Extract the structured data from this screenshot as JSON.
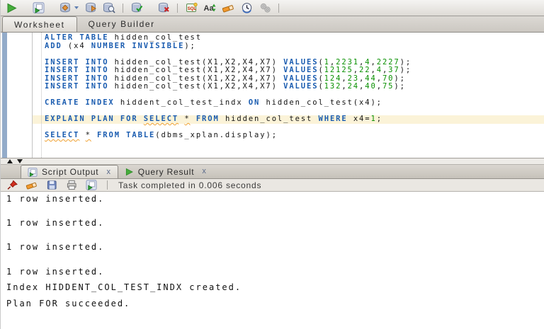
{
  "colors": {
    "keyword": "#1a5cb0",
    "number": "#089000",
    "highlight_line": "#fbf3d8",
    "squiggle": "#efa02f",
    "run_green": "#46ad3c",
    "error_red": "#cc2222"
  },
  "toolbar_main": {
    "icons": [
      "run-statement",
      "run-script",
      "autotrace",
      "explain-plan",
      "sql-tuning-advisor",
      "commit",
      "rollback",
      "unshared-worksheet",
      "case-toggle",
      "clear",
      "sql-history",
      "cancel-task"
    ]
  },
  "tabs_top": {
    "items": [
      {
        "label": "Worksheet",
        "active": true
      },
      {
        "label": "Query Builder",
        "active": false
      }
    ]
  },
  "editor": {
    "lines": [
      {
        "hl": false,
        "tokens": [
          {
            "t": "kw",
            "s": "ALTER TABLE"
          },
          {
            "t": "pl",
            "s": " hidden_col_test"
          }
        ]
      },
      {
        "hl": false,
        "tokens": [
          {
            "t": "kw",
            "s": "ADD"
          },
          {
            "t": "pl",
            "s": " (x4 "
          },
          {
            "t": "kw",
            "s": "NUMBER INVISIBLE"
          },
          {
            "t": "pl",
            "s": ");"
          }
        ]
      },
      {
        "hl": false,
        "tokens": []
      },
      {
        "hl": false,
        "tokens": [
          {
            "t": "kw",
            "s": "INSERT INTO"
          },
          {
            "t": "pl",
            "s": " hidden_col_test(X1,X2,X4,X7) "
          },
          {
            "t": "kw",
            "s": "VALUES"
          },
          {
            "t": "pl",
            "s": "("
          },
          {
            "t": "num",
            "s": "1"
          },
          {
            "t": "pl",
            "s": ","
          },
          {
            "t": "num",
            "s": "2231"
          },
          {
            "t": "pl",
            "s": ","
          },
          {
            "t": "num",
            "s": "4"
          },
          {
            "t": "pl",
            "s": ","
          },
          {
            "t": "num",
            "s": "2227"
          },
          {
            "t": "pl",
            "s": ");"
          }
        ]
      },
      {
        "hl": false,
        "tokens": [
          {
            "t": "kw",
            "s": "INSERT INTO"
          },
          {
            "t": "pl",
            "s": " hidden_col_test(X1,X2,X4,X7) "
          },
          {
            "t": "kw",
            "s": "VALUES"
          },
          {
            "t": "pl",
            "s": "("
          },
          {
            "t": "num",
            "s": "12125"
          },
          {
            "t": "pl",
            "s": ","
          },
          {
            "t": "num",
            "s": "22"
          },
          {
            "t": "pl",
            "s": ","
          },
          {
            "t": "num",
            "s": "4"
          },
          {
            "t": "pl",
            "s": ","
          },
          {
            "t": "num",
            "s": "37"
          },
          {
            "t": "pl",
            "s": ");"
          }
        ]
      },
      {
        "hl": false,
        "tokens": [
          {
            "t": "kw",
            "s": "INSERT INTO"
          },
          {
            "t": "pl",
            "s": " hidden_col_test(X1,X2,X4,X7) "
          },
          {
            "t": "kw",
            "s": "VALUES"
          },
          {
            "t": "pl",
            "s": "("
          },
          {
            "t": "num",
            "s": "124"
          },
          {
            "t": "pl",
            "s": ","
          },
          {
            "t": "num",
            "s": "23"
          },
          {
            "t": "pl",
            "s": ","
          },
          {
            "t": "num",
            "s": "44"
          },
          {
            "t": "pl",
            "s": ","
          },
          {
            "t": "num",
            "s": "70"
          },
          {
            "t": "pl",
            "s": ");"
          }
        ]
      },
      {
        "hl": false,
        "tokens": [
          {
            "t": "kw",
            "s": "INSERT INTO"
          },
          {
            "t": "pl",
            "s": " hidden_col_test(X1,X2,X4,X7) "
          },
          {
            "t": "kw",
            "s": "VALUES"
          },
          {
            "t": "pl",
            "s": "("
          },
          {
            "t": "num",
            "s": "132"
          },
          {
            "t": "pl",
            "s": ","
          },
          {
            "t": "num",
            "s": "24"
          },
          {
            "t": "pl",
            "s": ","
          },
          {
            "t": "num",
            "s": "40"
          },
          {
            "t": "pl",
            "s": ","
          },
          {
            "t": "num",
            "s": "75"
          },
          {
            "t": "pl",
            "s": ");"
          }
        ]
      },
      {
        "hl": false,
        "tokens": []
      },
      {
        "hl": false,
        "tokens": [
          {
            "t": "kw",
            "s": "CREATE INDEX"
          },
          {
            "t": "pl",
            "s": " hiddent_col_test_indx "
          },
          {
            "t": "kw",
            "s": "ON"
          },
          {
            "t": "pl",
            "s": " hidden_col_test(x4);"
          }
        ]
      },
      {
        "hl": false,
        "tokens": []
      },
      {
        "hl": true,
        "tokens": [
          {
            "t": "kw",
            "s": "EXPLAIN PLAN FOR"
          },
          {
            "t": "pl",
            "s": " "
          },
          {
            "t": "kwu",
            "s": "SELECT"
          },
          {
            "t": "pl",
            "s": " "
          },
          {
            "t": "stu",
            "s": "*"
          },
          {
            "t": "pl",
            "s": " "
          },
          {
            "t": "kw",
            "s": "FROM"
          },
          {
            "t": "pl",
            "s": " hidden_col_test "
          },
          {
            "t": "kw",
            "s": "WHERE"
          },
          {
            "t": "pl",
            "s": " x4="
          },
          {
            "t": "num",
            "s": "1"
          },
          {
            "t": "pl",
            "s": ";"
          }
        ]
      },
      {
        "hl": false,
        "tokens": []
      },
      {
        "hl": false,
        "tokens": [
          {
            "t": "kwu",
            "s": "SELECT"
          },
          {
            "t": "pl",
            "s": " "
          },
          {
            "t": "stu",
            "s": "*"
          },
          {
            "t": "pl",
            "s": " "
          },
          {
            "t": "kw",
            "s": "FROM TABLE"
          },
          {
            "t": "pl",
            "s": "(dbms_xplan.display);"
          }
        ]
      }
    ]
  },
  "tabs_bottom": {
    "items": [
      {
        "icon": "run-script",
        "label": "Script Output",
        "close": "x",
        "active": true
      },
      {
        "icon": "run-statement",
        "label": "Query Result",
        "close": "x",
        "active": false
      }
    ]
  },
  "toolbar_output": {
    "icons": [
      "pin",
      "clear",
      "save",
      "print",
      "run-script"
    ],
    "status": "Task completed in 0.006 seconds"
  },
  "output": {
    "lines": [
      "1 row inserted.",
      "",
      "",
      "1 row inserted.",
      "",
      "",
      "1 row inserted.",
      "",
      "",
      "1 row inserted.",
      "",
      "Index HIDDENT_COL_TEST_INDX created.",
      "",
      "Plan FOR succeeded."
    ]
  }
}
